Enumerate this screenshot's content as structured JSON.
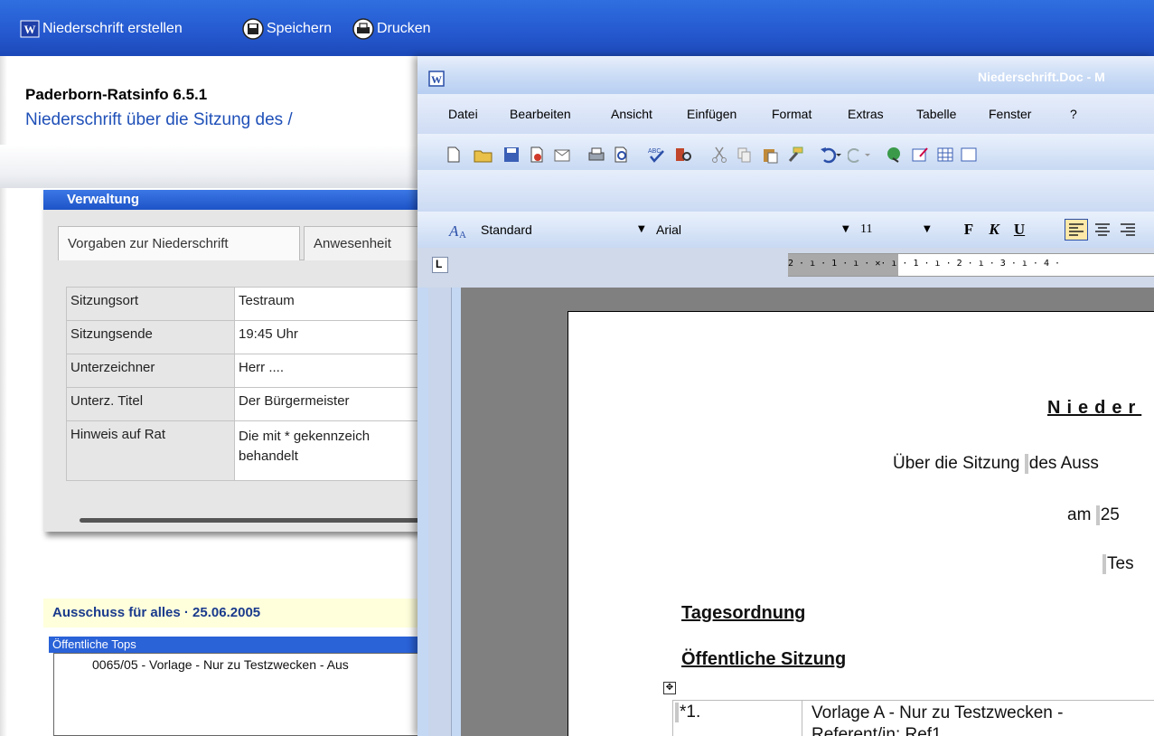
{
  "toolbar": {
    "create_label": "Niederschrift erstellen",
    "save_label": "Speichern",
    "print_label": "Drucken",
    "create_icon": "word-doc-icon",
    "save_icon": "floppy-disk-icon",
    "print_icon": "printer-icon"
  },
  "app": {
    "title": "Paderborn-Ratsinfo 6.5.1",
    "subtitle": "Niederschrift über die Sitzung des /"
  },
  "verwaltung": {
    "header": "Verwaltung",
    "tabs": [
      {
        "label": "Vorgaben zur Niederschrift"
      },
      {
        "label": "Anwesenheit"
      }
    ],
    "rows": [
      {
        "key": "Sitzungsort",
        "value": "Testraum"
      },
      {
        "key": "Sitzungsende",
        "value": "19:45 Uhr"
      },
      {
        "key": "Unterzeichner",
        "value": "Herr ...."
      },
      {
        "key": "Unterz. Titel",
        "value": "Der Bürgermeister"
      },
      {
        "key": "Hinweis auf Rat",
        "value": "Die mit * gekennzeich",
        "value2": "behandelt"
      }
    ]
  },
  "session": {
    "title": "Ausschuss für alles · 25.06.2005",
    "list_header": "Öffentliche Tops",
    "items": [
      {
        "label": "0065/05 - Vorlage - Nur zu Testzwecken - Aus"
      }
    ]
  },
  "word": {
    "title": "Niederschrift.Doc - M",
    "menus": [
      "Datei",
      "Bearbeiten",
      "Ansicht",
      "Einfügen",
      "Format",
      "Extras",
      "Tabelle",
      "Fenster",
      "?"
    ],
    "style_value": "Standard",
    "font_value": "Arial",
    "size_value": "11",
    "bold_label": "F",
    "italic_label": "K",
    "underline_label": "U",
    "tab_selector": "L",
    "ruler_text": "2 · ı · 1 · ı · ✕· ı · 1 · ı · 2 · ı · 3 · ı · 4 ·"
  },
  "document": {
    "heading": "Nieder",
    "line1_prefix": "Über die Sitzung ",
    "line1_suffix": "des Auss",
    "line2_prefix": "am ",
    "line2_suffix": "25",
    "line3": "Tes",
    "agenda": "Tagesordnung",
    "public_session": "Öffentliche Sitzung",
    "item_number": "*1.",
    "item_text": "Vorlage A - Nur zu Testzwecken -",
    "item_text2": "Referent/in: Ref1"
  },
  "colors": {
    "toolbar_blue": "#2558cf",
    "link_blue": "#1f50b8",
    "word_chrome": "#c4d7f3"
  }
}
